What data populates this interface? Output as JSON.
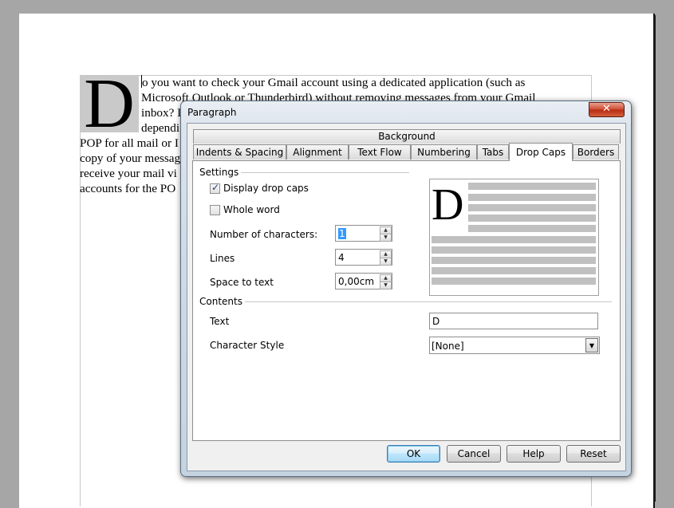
{
  "document": {
    "drop_cap_letter": "D",
    "lines": [
      "o you want to check your Gmail account using a dedicated application (such as",
      "Microsoft Outlook or Thunderbird) without removing messages from your Gmail",
      "inbox? I",
      "dependi",
      "POP for all mail or I",
      "copy of your messag",
      "receive your mail vi",
      "accounts for the PO"
    ]
  },
  "dialog": {
    "title": "Paragraph",
    "close_glyph": "✕",
    "top_tab": "Background",
    "tabs": [
      "Indents & Spacing",
      "Alignment",
      "Text Flow",
      "Numbering",
      "Tabs",
      "Drop Caps",
      "Borders"
    ],
    "active_tab": "Drop Caps",
    "settings": {
      "group_label": "Settings",
      "display_drop_caps": {
        "label": "Display drop caps",
        "checked": true
      },
      "whole_word": {
        "label": "Whole word",
        "checked": false
      },
      "number_of_characters": {
        "label": "Number of characters:",
        "value": "1"
      },
      "lines": {
        "label": "Lines",
        "value": "4"
      },
      "space_to_text": {
        "label": "Space to text",
        "value": "0,00cm"
      }
    },
    "preview": {
      "letter": "D"
    },
    "contents": {
      "group_label": "Contents",
      "text": {
        "label": "Text",
        "value": "D"
      },
      "character_style": {
        "label": "Character Style",
        "value": "[None]"
      }
    },
    "buttons": {
      "ok": "OK",
      "cancel": "Cancel",
      "help": "Help",
      "reset": "Reset"
    }
  },
  "icons": {
    "check": "check-icon",
    "spin_up": "spin-up-icon",
    "spin_down": "spin-down-icon",
    "dropdown": "chevron-down-icon",
    "close": "close-icon"
  }
}
